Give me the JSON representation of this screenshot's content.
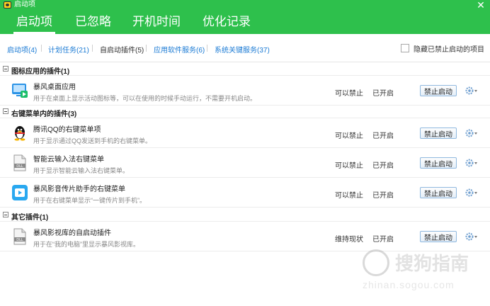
{
  "window": {
    "title": "启动项"
  },
  "main_tabs": [
    {
      "label": "启动项",
      "active": true
    },
    {
      "label": "已忽略"
    },
    {
      "label": "开机时间"
    },
    {
      "label": "优化记录"
    }
  ],
  "sub_tabs": [
    {
      "label": "启动项(4)"
    },
    {
      "label": "计划任务(21)"
    },
    {
      "label": "自启动插件(5)"
    },
    {
      "label": "应用软件服务(6)"
    },
    {
      "label": "系统关键服务(37)"
    }
  ],
  "hide_disabled_label": "隐藏已禁止启动的项目",
  "groups": [
    {
      "title": "图标应用的插件(1)",
      "items": [
        {
          "name": "暴风桌面应用",
          "desc": "用于在桌面上显示活动图标等，可以在使用的时候手动运行，不需要开机启动。",
          "can_disable": "可以禁止",
          "status": "已开启",
          "button": "禁止启动",
          "icon": "baofeng-desktop-icon"
        }
      ]
    },
    {
      "title": "右键菜单内的插件(3)",
      "items": [
        {
          "name": "腾讯QQ的右键菜单项",
          "desc": "用于显示通过QQ发送到手机的右键菜单。",
          "can_disable": "可以禁止",
          "status": "已开启",
          "button": "禁止启动",
          "icon": "qq-penguin-icon"
        },
        {
          "name": "智能云输入法右键菜单",
          "desc": "用于显示智能云输入法右键菜单。",
          "can_disable": "可以禁止",
          "status": "已开启",
          "button": "禁止启动",
          "icon": "dll-file-icon"
        },
        {
          "name": "暴风影音传片助手的右键菜单",
          "desc": "用于在右键菜单显示“一键传片到手机”。",
          "can_disable": "可以禁止",
          "status": "已开启",
          "button": "禁止启动",
          "icon": "baofeng-player-icon"
        }
      ]
    },
    {
      "title": "其它插件(1)",
      "items": [
        {
          "name": "暴风影视库的自启动插件",
          "desc": "用于在“我的电脑”里显示暴风影视库。",
          "can_disable": "维持现状",
          "status": "已开启",
          "button": "禁止启动",
          "icon": "dll-file-icon"
        }
      ]
    }
  ],
  "watermark": {
    "text": "搜狗指南",
    "url": "zhinan.sogou.com"
  },
  "colors": {
    "header": "#2ec04c",
    "link": "#1a7ad4",
    "button_border": "#8fb8de"
  }
}
